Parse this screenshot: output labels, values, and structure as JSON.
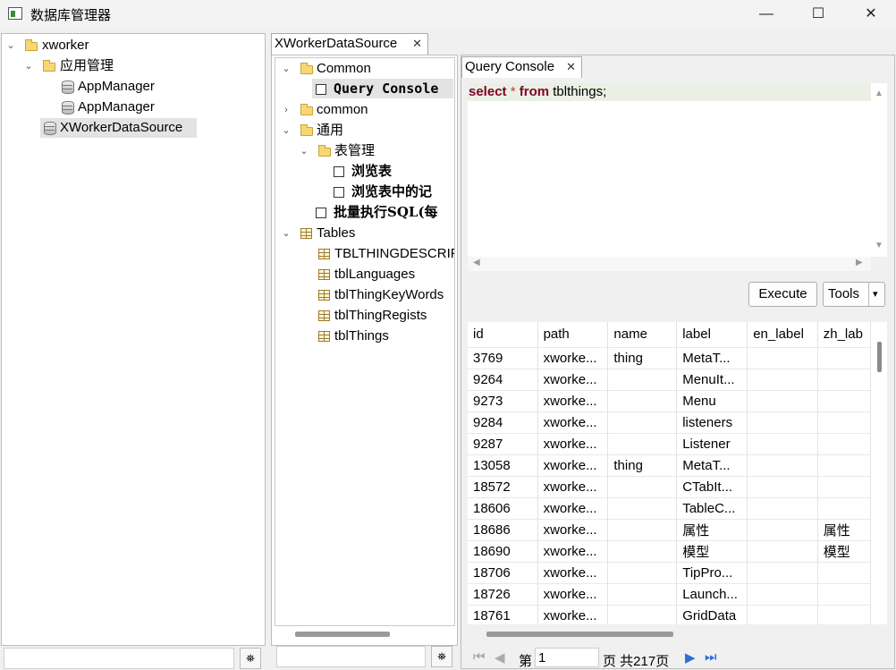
{
  "window": {
    "title": "数据库管理器",
    "minimize": "—",
    "maximize": "☐",
    "close": "✕"
  },
  "left_tree": {
    "root": "xworker",
    "folder": "应用管理",
    "app1": "AppManager",
    "app2": "AppManager",
    "datasource": "XWorkerDataSource"
  },
  "middle": {
    "tab_label": "XWorkerDataSource",
    "tree": {
      "common": "Common",
      "query_console": "Query Console",
      "common_lower": "common",
      "tongyong": "通用",
      "table_mgmt": "表管理",
      "browse_table": "浏览表",
      "browse_records": "浏览表中的记",
      "batch_sql": "批量执行SQL(每",
      "tables": "Tables",
      "t1": "TBLTHINGDESCRIP",
      "t2": "tblLanguages",
      "t3": "tblThingKeyWords",
      "t4": "tblThingRegists",
      "t5": "tblThings"
    }
  },
  "console": {
    "tab_label": "Query Console",
    "sql": {
      "kw_select": "select",
      "star": "*",
      "kw_from": "from",
      "rest": "tblthings;"
    },
    "execute_label": "Execute",
    "tools_label": "Tools"
  },
  "grid": {
    "columns": [
      "id",
      "path",
      "name",
      "label",
      "en_label",
      "zh_lab"
    ],
    "rows": [
      [
        "3769",
        "xworke...",
        "thing",
        "MetaT...",
        "",
        ""
      ],
      [
        "9264",
        "xworke...",
        "",
        "MenuIt...",
        "",
        ""
      ],
      [
        "9273",
        "xworke...",
        "",
        "Menu",
        "",
        ""
      ],
      [
        "9284",
        "xworke...",
        "",
        "listeners",
        "",
        ""
      ],
      [
        "9287",
        "xworke...",
        "",
        "Listener",
        "",
        ""
      ],
      [
        "13058",
        "xworke...",
        "thing",
        "MetaT...",
        "",
        ""
      ],
      [
        "18572",
        "xworke...",
        "",
        "CTabIt...",
        "",
        ""
      ],
      [
        "18606",
        "xworke...",
        "",
        "TableC...",
        "",
        ""
      ],
      [
        "18686",
        "xworke...",
        "",
        "属性",
        "",
        "属性"
      ],
      [
        "18690",
        "xworke...",
        "",
        "模型",
        "",
        "模型"
      ],
      [
        "18706",
        "xworke...",
        "",
        "TipPro...",
        "",
        ""
      ],
      [
        "18726",
        "xworke...",
        "",
        "Launch...",
        "",
        ""
      ],
      [
        "18761",
        "xworke...",
        "",
        "GridData",
        "",
        ""
      ]
    ]
  },
  "pager": {
    "prefix": "第",
    "page": "1",
    "suffix": "页 共217页"
  }
}
